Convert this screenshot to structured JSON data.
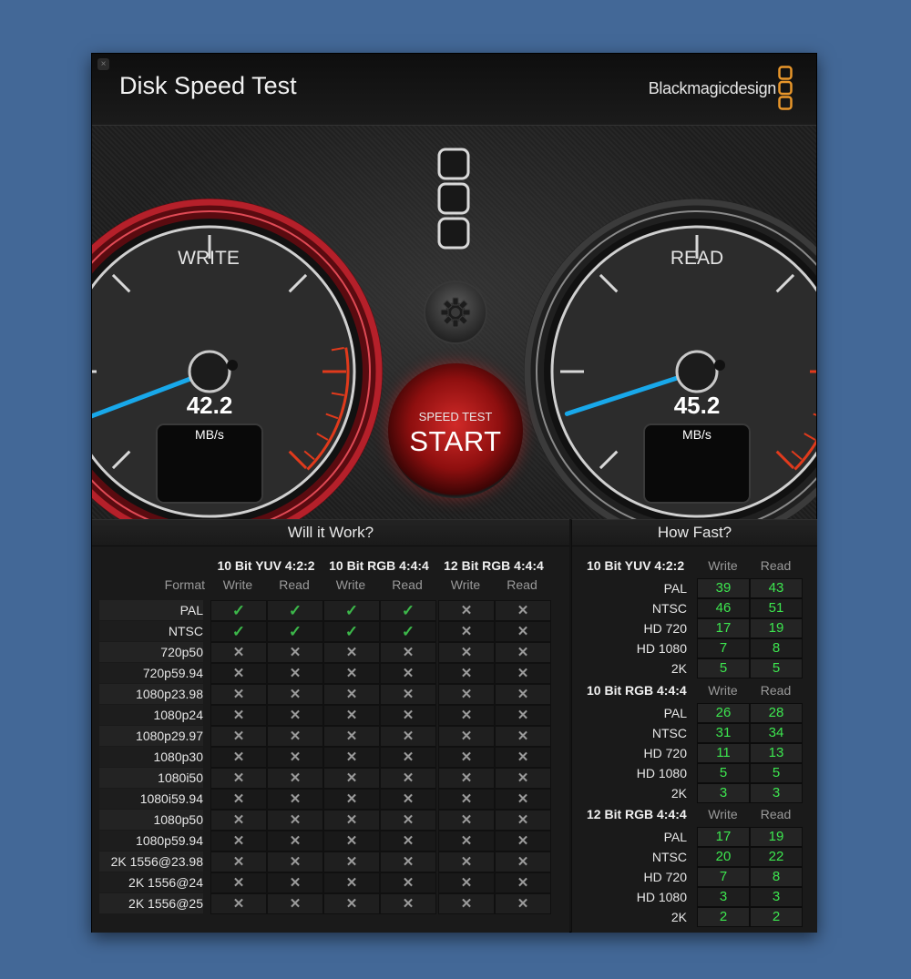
{
  "window": {
    "title": "Disk Speed Test",
    "brand": "Blackmagicdesign",
    "close_glyph": "×"
  },
  "gauges": {
    "write": {
      "label": "WRITE",
      "value": "42.2",
      "unit": "MB/s",
      "needle_fraction": 0.09,
      "ring_color": "#c8222a"
    },
    "read": {
      "label": "READ",
      "value": "45.2",
      "unit": "MB/s",
      "needle_fraction": 0.1,
      "ring_color": "#3a3a3a"
    }
  },
  "start_button": {
    "small_label": "SPEED TEST",
    "big_label": "START"
  },
  "settings_button": {
    "icon": "gear-icon"
  },
  "will_it_work": {
    "title": "Will it Work?",
    "format_header": "Format",
    "groups": [
      "10 Bit YUV 4:2:2",
      "10 Bit RGB 4:4:4",
      "12 Bit RGB 4:4:4"
    ],
    "columns": [
      "Write",
      "Read",
      "Write",
      "Read",
      "Write",
      "Read"
    ],
    "rows": [
      {
        "format": "PAL",
        "results": [
          true,
          true,
          true,
          true,
          false,
          false
        ]
      },
      {
        "format": "NTSC",
        "results": [
          true,
          true,
          true,
          true,
          false,
          false
        ]
      },
      {
        "format": "720p50",
        "results": [
          false,
          false,
          false,
          false,
          false,
          false
        ]
      },
      {
        "format": "720p59.94",
        "results": [
          false,
          false,
          false,
          false,
          false,
          false
        ]
      },
      {
        "format": "1080p23.98",
        "results": [
          false,
          false,
          false,
          false,
          false,
          false
        ]
      },
      {
        "format": "1080p24",
        "results": [
          false,
          false,
          false,
          false,
          false,
          false
        ]
      },
      {
        "format": "1080p29.97",
        "results": [
          false,
          false,
          false,
          false,
          false,
          false
        ]
      },
      {
        "format": "1080p30",
        "results": [
          false,
          false,
          false,
          false,
          false,
          false
        ]
      },
      {
        "format": "1080i50",
        "results": [
          false,
          false,
          false,
          false,
          false,
          false
        ]
      },
      {
        "format": "1080i59.94",
        "results": [
          false,
          false,
          false,
          false,
          false,
          false
        ]
      },
      {
        "format": "1080p50",
        "results": [
          false,
          false,
          false,
          false,
          false,
          false
        ]
      },
      {
        "format": "1080p59.94",
        "results": [
          false,
          false,
          false,
          false,
          false,
          false
        ]
      },
      {
        "format": "2K 1556@23.98",
        "results": [
          false,
          false,
          false,
          false,
          false,
          false
        ]
      },
      {
        "format": "2K 1556@24",
        "results": [
          false,
          false,
          false,
          false,
          false,
          false
        ]
      },
      {
        "format": "2K 1556@25",
        "results": [
          false,
          false,
          false,
          false,
          false,
          false
        ]
      }
    ],
    "check_glyph": "✓",
    "cross_glyph": "✕"
  },
  "how_fast": {
    "title": "How Fast?",
    "sections": [
      {
        "name": "10 Bit YUV 4:2:2",
        "write_label": "Write",
        "read_label": "Read",
        "rows": [
          {
            "format": "PAL",
            "write": "39",
            "read": "43"
          },
          {
            "format": "NTSC",
            "write": "46",
            "read": "51"
          },
          {
            "format": "HD 720",
            "write": "17",
            "read": "19"
          },
          {
            "format": "HD 1080",
            "write": "7",
            "read": "8"
          },
          {
            "format": "2K",
            "write": "5",
            "read": "5"
          }
        ]
      },
      {
        "name": "10 Bit RGB 4:4:4",
        "write_label": "Write",
        "read_label": "Read",
        "rows": [
          {
            "format": "PAL",
            "write": "26",
            "read": "28"
          },
          {
            "format": "NTSC",
            "write": "31",
            "read": "34"
          },
          {
            "format": "HD 720",
            "write": "11",
            "read": "13"
          },
          {
            "format": "HD 1080",
            "write": "5",
            "read": "5"
          },
          {
            "format": "2K",
            "write": "3",
            "read": "3"
          }
        ]
      },
      {
        "name": "12 Bit RGB 4:4:4",
        "write_label": "Write",
        "read_label": "Read",
        "rows": [
          {
            "format": "PAL",
            "write": "17",
            "read": "19"
          },
          {
            "format": "NTSC",
            "write": "20",
            "read": "22"
          },
          {
            "format": "HD 720",
            "write": "7",
            "read": "8"
          },
          {
            "format": "HD 1080",
            "write": "3",
            "read": "3"
          },
          {
            "format": "2K",
            "write": "2",
            "read": "2"
          }
        ]
      }
    ]
  },
  "colors": {
    "desktop": "#436897",
    "accent_green": "#3de64f",
    "needle": "#1aa6e6",
    "brand_orange": "#e8962a"
  }
}
